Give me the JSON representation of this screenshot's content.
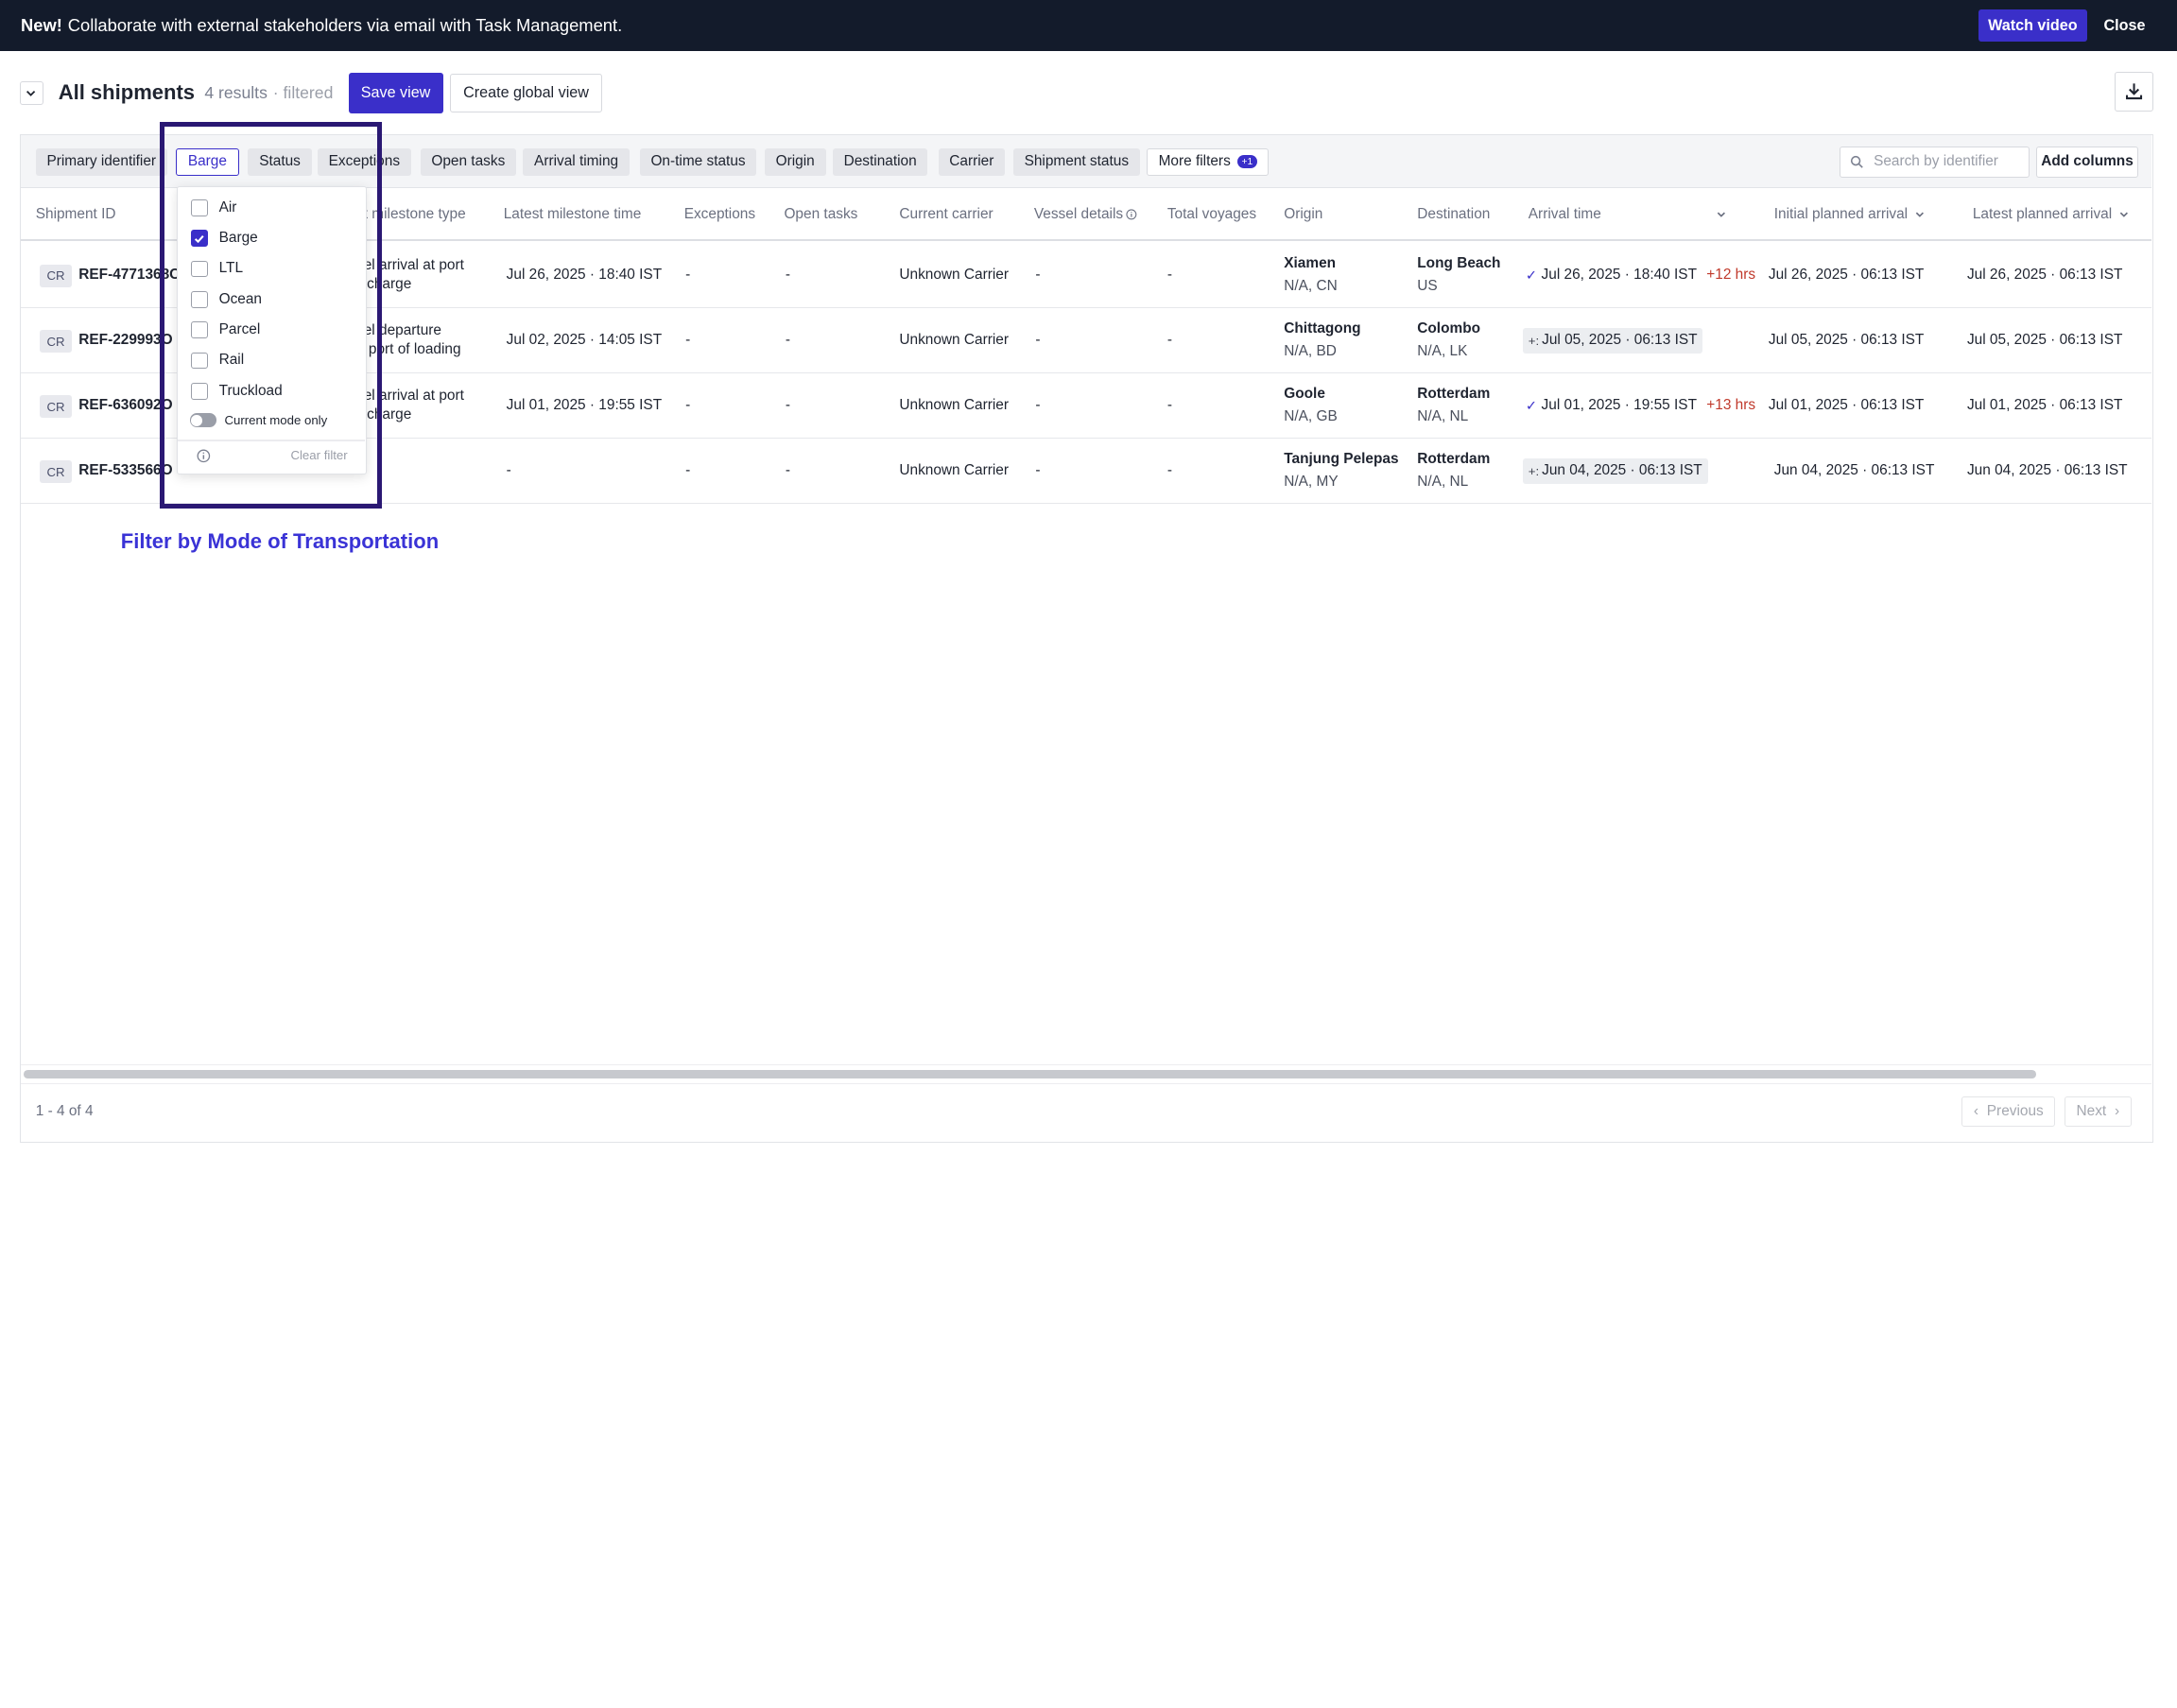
{
  "banner": {
    "prefix": "New!",
    "text": "Collaborate with external stakeholders via email with Task Management.",
    "watch_label": "Watch video",
    "close_label": "Close"
  },
  "header": {
    "title": "All shipments",
    "results": "4 results",
    "filtered": "· filtered",
    "save_view": "Save view",
    "create_global_view": "Create global view"
  },
  "filters": {
    "chips": [
      "Primary identifier",
      "Barge",
      "Status",
      "Exceptions",
      "Open tasks",
      "Arrival timing",
      "On-time status",
      "Origin",
      "Destination",
      "Carrier",
      "Shipment status",
      "More filters"
    ],
    "more_badge": "+1",
    "search_placeholder": "Search by identifier",
    "add_columns": "Add columns"
  },
  "columns": [
    "Shipment ID",
    "Latest milestone type",
    "Latest milestone time",
    "Exceptions",
    "Open tasks",
    "Current carrier",
    "Vessel details",
    "Total voyages",
    "Origin",
    "Destination",
    "Arrival time",
    "Initial planned arrival",
    "Latest planned arrival"
  ],
  "column_visible_label": "st milestone type",
  "rows": [
    {
      "badge": "CR",
      "id": "REF-4771368OC",
      "milestone_type_1": "sel arrival at port",
      "milestone_type_2": "ischarge",
      "milestone_time": "Jul 26, 2025 · 18:40 IST",
      "exceptions": "-",
      "open_tasks": "-",
      "carrier": "Unknown Carrier",
      "vessel": "-",
      "voyages": "-",
      "origin_city": "Xiamen",
      "origin_region": "N/A, CN",
      "dest_city": "Long Beach",
      "dest_region": "US",
      "arrival": "Jul 26, 2025 · 18:40 IST",
      "arrival_delta": "+12 hrs",
      "arrival_icon": "check-icon",
      "initial": "Jul 26, 2025 · 06:13 IST",
      "latest": "Jul 26, 2025 · 06:13 IST"
    },
    {
      "badge": "CR",
      "id": "REF-229993O",
      "milestone_type_1": "sel departure",
      "milestone_type_2": "n port of loading",
      "milestone_time": "Jul 02, 2025 · 14:05 IST",
      "exceptions": "-",
      "open_tasks": "-",
      "carrier": "Unknown Carrier",
      "vessel": "-",
      "voyages": "-",
      "origin_city": "Chittagong",
      "origin_region": "N/A, BD",
      "dest_city": "Colombo",
      "dest_region": "N/A, LK",
      "arrival": "Jul 05, 2025 · 06:13 IST",
      "arrival_delta": "",
      "arrival_icon": "estimate-icon",
      "initial": "Jul 05, 2025 · 06:13 IST",
      "latest": "Jul 05, 2025 · 06:13 IST"
    },
    {
      "badge": "CR",
      "id": "REF-636092O",
      "milestone_type_1": "sel arrival at port",
      "milestone_type_2": "ischarge",
      "milestone_time": "Jul 01, 2025 · 19:55 IST",
      "exceptions": "-",
      "open_tasks": "-",
      "carrier": "Unknown Carrier",
      "vessel": "-",
      "voyages": "-",
      "origin_city": "Goole",
      "origin_region": "N/A, GB",
      "dest_city": "Rotterdam",
      "dest_region": "N/A, NL",
      "arrival": "Jul 01, 2025 · 19:55 IST",
      "arrival_delta": "+13 hrs",
      "arrival_icon": "check-icon",
      "initial": "Jul 01, 2025 · 06:13 IST",
      "latest": "Jul 01, 2025 · 06:13 IST"
    },
    {
      "badge": "CR",
      "id": "REF-533566O",
      "milestone_type_1": "",
      "milestone_type_2": "",
      "milestone_time": "-",
      "exceptions": "-",
      "open_tasks": "-",
      "carrier": "Unknown Carrier",
      "vessel": "-",
      "voyages": "-",
      "origin_city": "Tanjung Pelepas",
      "origin_region": "N/A, MY",
      "dest_city": "Rotterdam",
      "dest_region": "N/A, NL",
      "arrival": "Jun 04, 2025 · 06:13 IST",
      "arrival_delta": "",
      "arrival_icon": "estimate-icon",
      "initial": "Jun 04, 2025 · 06:13 IST",
      "latest": "Jun 04, 2025 · 06:13 IST"
    }
  ],
  "mode_filter": {
    "options": [
      {
        "label": "Air",
        "checked": false
      },
      {
        "label": "Barge",
        "checked": true
      },
      {
        "label": "LTL",
        "checked": false
      },
      {
        "label": "Ocean",
        "checked": false
      },
      {
        "label": "Parcel",
        "checked": false
      },
      {
        "label": "Rail",
        "checked": false
      },
      {
        "label": "Truckload",
        "checked": false
      }
    ],
    "toggle_label": "Current mode only",
    "clear_label": "Clear filter"
  },
  "pagination": {
    "range": "1 - 4 of 4",
    "previous": "Previous",
    "next": "Next"
  },
  "annotation": "Filter by Mode of Transportation",
  "colors": {
    "accent": "#3a2fc9",
    "banner_bg": "#131b2b",
    "late": "#c0392b",
    "annotation": "#3a33d6",
    "highlight_border": "#2a1873"
  }
}
